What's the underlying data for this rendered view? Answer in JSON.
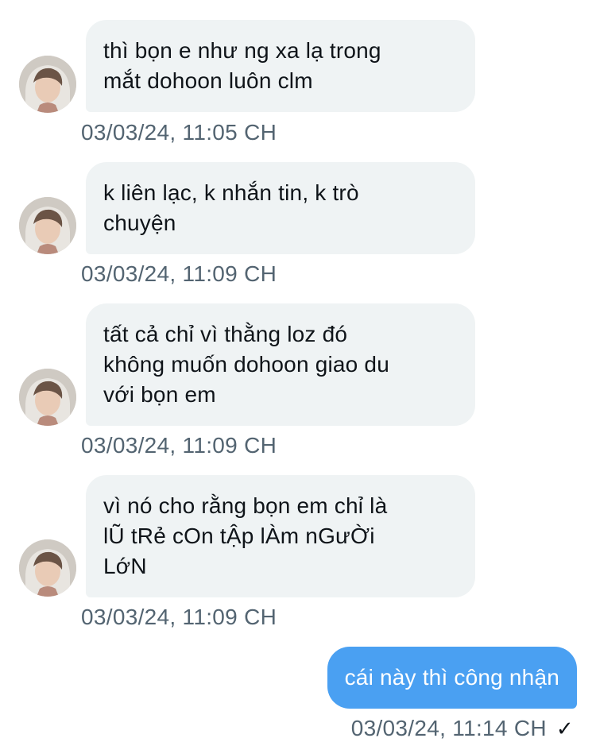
{
  "messages": [
    {
      "text": "thì bọn e như ng xa lạ trong\nmắt dohoon luôn clm",
      "time": "03/03/24, 11:05 CH"
    },
    {
      "text": "k liên lạc, k nhắn tin, k trò\nchuyện",
      "time": "03/03/24, 11:09 CH"
    },
    {
      "text": "tất cả chỉ vì thằng loz đó\nkhông muốn dohoon giao du\nvới bọn em",
      "time": "03/03/24, 11:09 CH"
    },
    {
      "text": "vì nó cho rằng bọn em chỉ là\nlŨ tRẻ cOn tẬp lÀm nGưỜi\nLớN",
      "time": "03/03/24, 11:09 CH"
    }
  ],
  "sent": {
    "text": "cái này thì công nhận",
    "time": "03/03/24, 11:14 CH",
    "status_icon": "✓"
  },
  "colors": {
    "incoming_bg": "#eff3f4",
    "outgoing_bg": "#4aa0f2",
    "timestamp": "#536471"
  },
  "icons": {
    "avatar": "user-avatar",
    "status": "check-icon"
  }
}
